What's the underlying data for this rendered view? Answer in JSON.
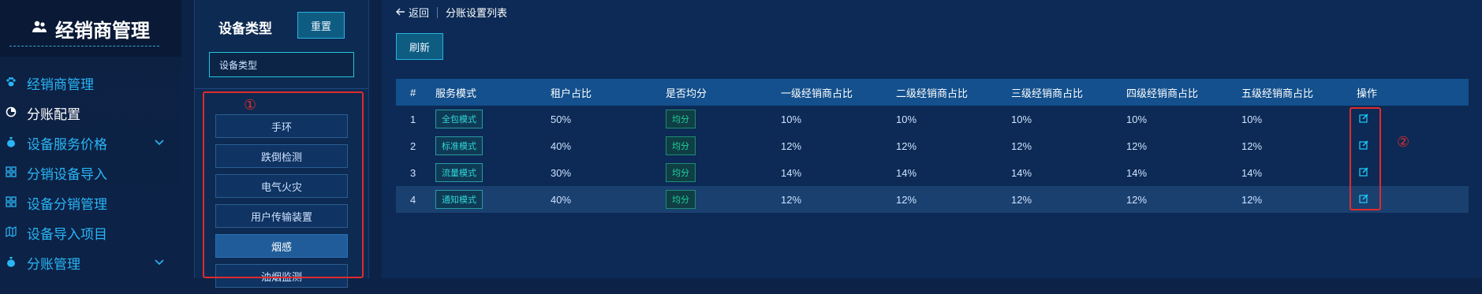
{
  "sidebar": {
    "brand_icon": "users-icon",
    "brand": "经销商管理",
    "items": [
      {
        "label": "经销商管理",
        "icon": "paw-icon",
        "active": false,
        "chevron": false
      },
      {
        "label": "分账配置",
        "icon": "pie-icon",
        "active": true,
        "chevron": false
      },
      {
        "label": "设备服务价格",
        "icon": "money-bag-icon",
        "active": false,
        "chevron": true
      },
      {
        "label": "分销设备导入",
        "icon": "grid-icon",
        "active": false,
        "chevron": false
      },
      {
        "label": "设备分销管理",
        "icon": "grid-icon",
        "active": false,
        "chevron": false
      },
      {
        "label": "设备导入项目",
        "icon": "map-icon",
        "active": false,
        "chevron": false
      },
      {
        "label": "分账管理",
        "icon": "money-bag-icon",
        "active": false,
        "chevron": true
      }
    ]
  },
  "device_panel": {
    "title": "设备类型",
    "reset_label": "重置",
    "input_placeholder": "设备类型",
    "annotation": "①",
    "items": [
      "手环",
      "跌倒检测",
      "电气火灾",
      "用户传输装置",
      "烟感",
      "油烟监测"
    ],
    "selected_index": 4
  },
  "main": {
    "back_label": "返回",
    "page_title": "分账设置列表",
    "refresh_label": "刷新",
    "annotation": "②",
    "columns": [
      "#",
      "服务模式",
      "租户占比",
      "是否均分",
      "一级经销商占比",
      "二级经销商占比",
      "三级经销商占比",
      "四级经销商占比",
      "五级经销商占比",
      "操作"
    ],
    "rows": [
      {
        "id": "1",
        "mode": "全包模式",
        "tenant": "50%",
        "even": "均分",
        "l1": "10%",
        "l2": "10%",
        "l3": "10%",
        "l4": "10%",
        "l5": "10%"
      },
      {
        "id": "2",
        "mode": "标准模式",
        "tenant": "40%",
        "even": "均分",
        "l1": "12%",
        "l2": "12%",
        "l3": "12%",
        "l4": "12%",
        "l5": "12%"
      },
      {
        "id": "3",
        "mode": "流量模式",
        "tenant": "30%",
        "even": "均分",
        "l1": "14%",
        "l2": "14%",
        "l3": "14%",
        "l4": "14%",
        "l5": "14%"
      },
      {
        "id": "4",
        "mode": "通知模式",
        "tenant": "40%",
        "even": "均分",
        "l1": "12%",
        "l2": "12%",
        "l3": "12%",
        "l4": "12%",
        "l5": "12%"
      }
    ]
  },
  "colors": {
    "background": "#0c2347",
    "accent": "#29b6f6",
    "annotation_red": "#e02b2b"
  }
}
